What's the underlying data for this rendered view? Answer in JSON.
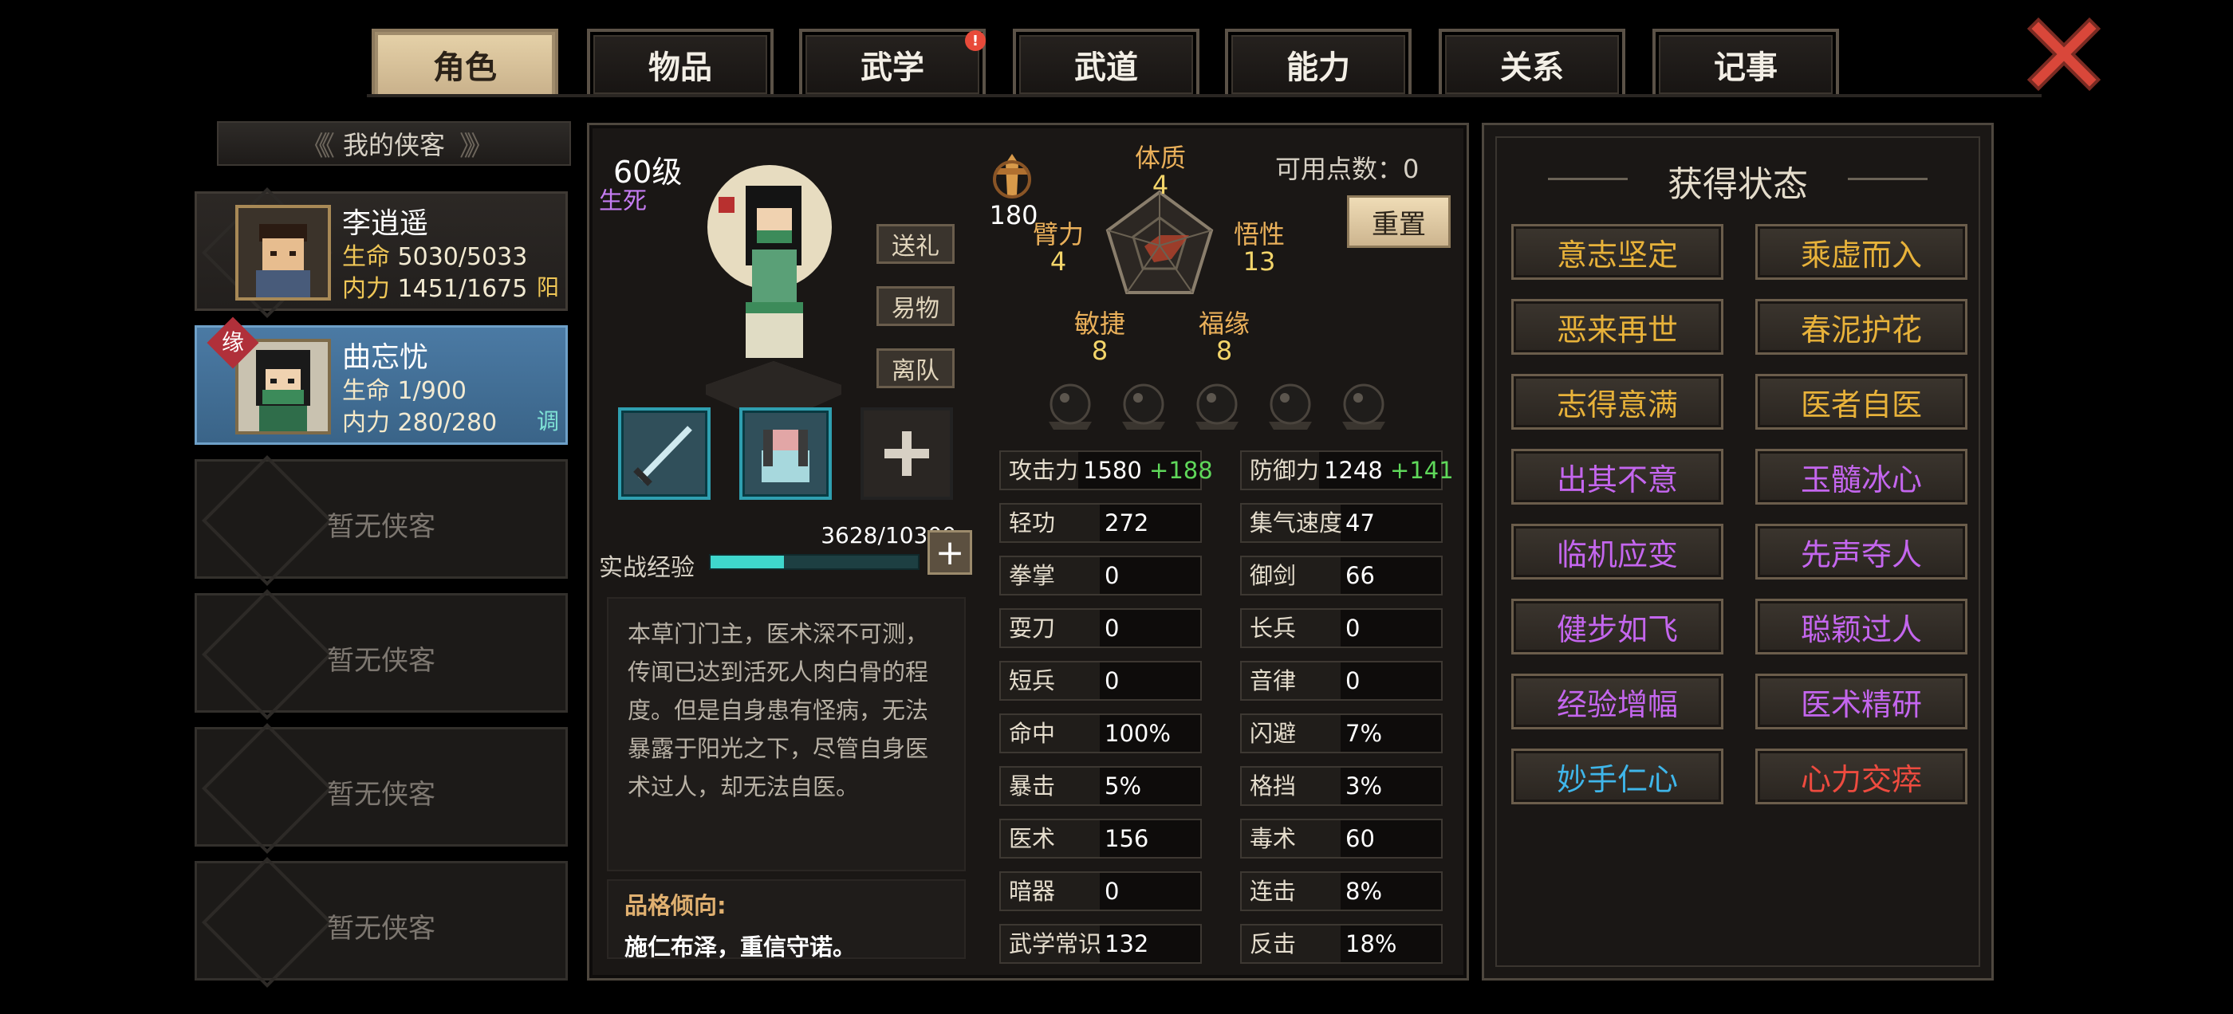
{
  "tabs": [
    {
      "label": "角色",
      "active": true
    },
    {
      "label": "物品",
      "active": false
    },
    {
      "label": "武学",
      "active": false,
      "badge": "!"
    },
    {
      "label": "武道",
      "active": false
    },
    {
      "label": "能力",
      "active": false
    },
    {
      "label": "关系",
      "active": false
    },
    {
      "label": "记事",
      "active": false
    }
  ],
  "roster": {
    "header": "我的侠客",
    "members": [
      {
        "name": "李逍遥",
        "hp_label": "生命",
        "hp": "5030/5033",
        "mp_label": "内力",
        "mp": "1451/1675",
        "tag": "阳",
        "tag_color": "#f0c757"
      },
      {
        "name": "曲忘忧",
        "hp_label": "生命",
        "hp": "1/900",
        "mp_label": "内力",
        "mp": "280/280",
        "tag": "调",
        "tag_color": "#7fe3d6",
        "badge": "缘"
      }
    ],
    "empty_label": "暂无侠客"
  },
  "character": {
    "level": "60级",
    "status": "生死",
    "actions": [
      "送礼",
      "易物",
      "离队"
    ],
    "exp_label": "实战经验",
    "exp_text": "3628/10300",
    "exp_fraction": 0.352,
    "description": "本草门门主，医术深不可测，传闻已达到活死人肉白骨的程度。但是自身患有怪病，无法暴露于阳光之下，尽管自身医术过人，却无法自医。",
    "trait_label": "品格倾向:",
    "trait_value": "施仁布泽，重信守诺。",
    "reputation": "180"
  },
  "radar": {
    "stats": [
      {
        "name": "体质",
        "value": "4"
      },
      {
        "name": "悟性",
        "value": "13"
      },
      {
        "name": "福缘",
        "value": "8"
      },
      {
        "name": "敏捷",
        "value": "8"
      },
      {
        "name": "臂力",
        "value": "4"
      }
    ],
    "points_label": "可用点数：",
    "points": "0",
    "reset": "重置"
  },
  "attributes": {
    "left": [
      {
        "k": "攻击力",
        "v": "1580",
        "bonus": "+188"
      },
      {
        "k": "轻功",
        "v": "272"
      },
      {
        "k": "拳掌",
        "v": "0"
      },
      {
        "k": "耍刀",
        "v": "0"
      },
      {
        "k": "短兵",
        "v": "0"
      },
      {
        "k": "命中",
        "v": "100%"
      },
      {
        "k": "暴击",
        "v": "5%"
      },
      {
        "k": "医术",
        "v": "156"
      },
      {
        "k": "暗器",
        "v": "0"
      },
      {
        "k": "武学常识",
        "v": "132"
      }
    ],
    "right": [
      {
        "k": "防御力",
        "v": "1248",
        "bonus": "+141"
      },
      {
        "k": "集气速度",
        "v": "47"
      },
      {
        "k": "御剑",
        "v": "66"
      },
      {
        "k": "长兵",
        "v": "0"
      },
      {
        "k": "音律",
        "v": "0"
      },
      {
        "k": "闪避",
        "v": "7%"
      },
      {
        "k": "格挡",
        "v": "3%"
      },
      {
        "k": "毒术",
        "v": "60"
      },
      {
        "k": "连击",
        "v": "8%"
      },
      {
        "k": "反击",
        "v": "18%"
      }
    ]
  },
  "status_panel": {
    "title": "获得状态",
    "items": [
      {
        "label": "意志坚定",
        "color": "#e8b23a"
      },
      {
        "label": "乘虚而入",
        "color": "#e8b23a"
      },
      {
        "label": "恶来再世",
        "color": "#e8b23a"
      },
      {
        "label": "春泥护花",
        "color": "#e8b23a"
      },
      {
        "label": "志得意满",
        "color": "#e8b23a"
      },
      {
        "label": "医者自医",
        "color": "#e8b23a"
      },
      {
        "label": "出其不意",
        "color": "#c466ee"
      },
      {
        "label": "玉髓冰心",
        "color": "#c466ee"
      },
      {
        "label": "临机应变",
        "color": "#c466ee"
      },
      {
        "label": "先声夺人",
        "color": "#c466ee"
      },
      {
        "label": "健步如飞",
        "color": "#c466ee"
      },
      {
        "label": "聪颖过人",
        "color": "#c466ee"
      },
      {
        "label": "经验增幅",
        "color": "#c466ee"
      },
      {
        "label": "医术精研",
        "color": "#c466ee"
      },
      {
        "label": "妙手仁心",
        "color": "#3fb6ea"
      },
      {
        "label": "心力交瘁",
        "color": "#ee4b3f"
      }
    ]
  },
  "icons": {
    "close": "close-x-icon",
    "weapon": "sword-icon",
    "armor": "robe-icon",
    "add_equip": "plus-icon",
    "reputation": "sword-emblem-icon",
    "orb": "socket-orb-icon"
  }
}
